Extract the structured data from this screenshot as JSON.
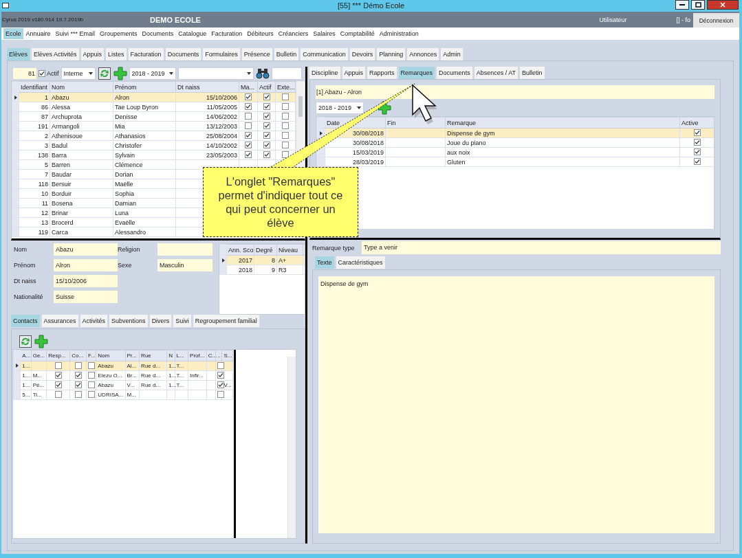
{
  "window": {
    "title": "[55] *** Démo Ecole"
  },
  "header": {
    "version": "Cyrus 2019 v180.914 19.7.2019b",
    "school": "DEMO ECOLE",
    "user_label": "Utilisateur",
    "user_value": "[] - fo",
    "logout": "Déconnexion"
  },
  "main_menu": [
    {
      "label": "Ecole",
      "selected": true
    },
    {
      "label": "Annuaire",
      "selected": false
    },
    {
      "label": "Suivi *** Email",
      "selected": false
    },
    {
      "label": "Groupements",
      "selected": false
    },
    {
      "label": "Documents",
      "selected": false
    },
    {
      "label": "Catalogue",
      "selected": false
    },
    {
      "label": "Facturation",
      "selected": false
    },
    {
      "label": "Débiteurs",
      "selected": false
    },
    {
      "label": "Créanciers",
      "selected": false
    },
    {
      "label": "Salaires",
      "selected": false
    },
    {
      "label": "Comptabilité",
      "selected": false
    },
    {
      "label": "Administration",
      "selected": false
    }
  ],
  "sub_tabs": [
    {
      "label": "Elèves",
      "selected": true
    },
    {
      "label": "Elèves Activités",
      "selected": false
    },
    {
      "label": "Appuis",
      "selected": false
    },
    {
      "label": "Listes",
      "selected": false
    },
    {
      "label": "Facturation",
      "selected": false
    },
    {
      "label": "Documents",
      "selected": false
    },
    {
      "label": "Formulaires",
      "selected": false
    },
    {
      "label": "Présence",
      "selected": false
    },
    {
      "label": "Bulletin",
      "selected": false
    },
    {
      "label": "Communication",
      "selected": false
    },
    {
      "label": "Devoirs",
      "selected": false
    },
    {
      "label": "Planning",
      "selected": false
    },
    {
      "label": "Annonces",
      "selected": false
    },
    {
      "label": "Admin",
      "selected": false
    }
  ],
  "students": {
    "toolbar": {
      "count": "81",
      "active": {
        "label": "Actif",
        "checked": true
      },
      "type": "Interne",
      "year": "2018 - 2019"
    },
    "columns": [
      "Identifiant",
      "Nom",
      "Prénom",
      "Dt naiss",
      "Ma...",
      "Actif",
      "Exte..."
    ],
    "rows": [
      {
        "id": "1",
        "nom": "Abazu",
        "prenom": "Alron",
        "dob": "15/10/2006",
        "checks": [
          true,
          true,
          false
        ],
        "selected": true
      },
      {
        "id": "86",
        "nom": "Alessa",
        "prenom": "Tae Loup Byron",
        "dob": "11/05/2005",
        "checks": [
          true,
          true,
          false
        ],
        "selected": false
      },
      {
        "id": "87",
        "nom": "Archuprota",
        "prenom": "Denisse",
        "dob": "14/06/2002",
        "checks": [
          false,
          true,
          false
        ],
        "selected": false
      },
      {
        "id": "191",
        "nom": "Armangoli",
        "prenom": "Mia",
        "dob": "13/12/2003",
        "checks": [
          false,
          true,
          false
        ],
        "selected": false
      },
      {
        "id": "2",
        "nom": "Athenisoue",
        "prenom": "Athanasios",
        "dob": "25/08/2004",
        "checks": [
          true,
          true,
          false
        ],
        "selected": false
      },
      {
        "id": "3",
        "nom": "Badul",
        "prenom": "Christofer",
        "dob": "14/10/2002",
        "checks": [
          true,
          true,
          false
        ],
        "selected": false
      },
      {
        "id": "138",
        "nom": "Barra",
        "prenom": "Sylvain",
        "dob": "23/05/2003",
        "checks": [
          true,
          true,
          false
        ],
        "selected": false
      },
      {
        "id": "5",
        "nom": "Barren",
        "prenom": "Clémence",
        "selected": false
      },
      {
        "id": "7",
        "nom": "Baudar",
        "prenom": "Dorian",
        "selected": false
      },
      {
        "id": "118",
        "nom": "Bersuir",
        "prenom": "Maëlle",
        "selected": false
      },
      {
        "id": "10",
        "nom": "Borduir",
        "prenom": "Sophia",
        "selected": false
      },
      {
        "id": "11",
        "nom": "Bosena",
        "prenom": "Damian",
        "selected": false
      },
      {
        "id": "12",
        "nom": "Brinar",
        "prenom": "Luna",
        "selected": false
      },
      {
        "id": "13",
        "nom": "Brocerd",
        "prenom": "Evaëlle",
        "selected": false
      },
      {
        "id": "119",
        "nom": "Carca",
        "prenom": "Alessandro",
        "selected": false
      }
    ]
  },
  "form": {
    "left_fields": [
      {
        "label": "Nom",
        "value": "Abazu"
      },
      {
        "label": "Prénom",
        "value": "Alron"
      },
      {
        "label": "Dt naiss",
        "value": "15/10/2006"
      },
      {
        "label": "Nationalité",
        "value": "Suisse"
      }
    ],
    "right_fields": [
      {
        "label": "Religion"
      },
      {
        "label": "Sexe",
        "value": "Masculin"
      }
    ]
  },
  "years": {
    "columns": [
      "Ann. Sco",
      "Degré",
      "Niveau"
    ],
    "rows": [
      {
        "cells": [
          "2017",
          "8",
          "A+"
        ],
        "selected": true
      },
      {
        "cells": [
          "2018",
          "9",
          "R3"
        ],
        "selected": false
      }
    ]
  },
  "family_tabs": [
    {
      "label": "Contacts",
      "selected": true
    },
    {
      "label": "Assurances",
      "selected": false
    },
    {
      "label": "Activités",
      "selected": false
    },
    {
      "label": "Subventions",
      "selected": false
    },
    {
      "label": "Divers",
      "selected": false
    },
    {
      "label": "Suivi",
      "selected": false
    },
    {
      "label": "Regroupement familial",
      "selected": false
    }
  ],
  "contacts": {
    "columns": [
      {
        "label": "A...",
        "kind": "text"
      },
      {
        "label": "Ge...",
        "kind": "text"
      },
      {
        "label": "Resp...",
        "kind": "check"
      },
      {
        "label": "Co...",
        "kind": "check"
      },
      {
        "label": "F...",
        "kind": "check"
      },
      {
        "label": "Nom",
        "kind": "text"
      },
      {
        "label": "Pr...",
        "kind": "text"
      },
      {
        "label": "Rue",
        "kind": "text"
      },
      {
        "label": "N",
        "kind": "text"
      },
      {
        "label": "L...",
        "kind": "text"
      },
      {
        "label": "Prof...",
        "kind": "text"
      },
      {
        "label": "C...",
        "kind": "text"
      },
      {
        "label": "..",
        "kind": "check"
      },
      {
        "label": "S...",
        "kind": "text"
      }
    ],
    "rows": [
      {
        "cells": [
          "1...",
          null,
          false,
          false,
          false,
          "Abazu",
          "Al...",
          "Rue d...",
          "1...",
          "T...",
          null,
          null,
          false,
          null
        ],
        "selected": true
      },
      {
        "cells": [
          "1...",
          "M...",
          true,
          true,
          false,
          "Elezu O...",
          "Br...",
          "Rue d...",
          "1...",
          "T...",
          "Infir...",
          null,
          true,
          null
        ],
        "selected": false
      },
      {
        "cells": [
          "1...",
          "Pè...",
          true,
          true,
          false,
          "Abazu",
          "V...",
          "Rue d...",
          "1...",
          "T...",
          null,
          null,
          true,
          "V..."
        ],
        "selected": false
      },
      {
        "cells": [
          "5...",
          "Ti...",
          false,
          false,
          false,
          "UDRISA...",
          "M...",
          null,
          null,
          null,
          null,
          null,
          false,
          null
        ],
        "selected": false
      }
    ]
  },
  "detail": {
    "tabs": [
      {
        "label": "Discipline",
        "selected": false
      },
      {
        "label": "Appuis",
        "selected": false
      },
      {
        "label": "Rapports",
        "selected": false
      },
      {
        "label": "Remarques",
        "selected": true
      },
      {
        "label": "Documents",
        "selected": false
      },
      {
        "label": "Absences / AT",
        "selected": false
      },
      {
        "label": "Bulletin",
        "selected": false
      }
    ],
    "student": "[1] Abazu - Alron",
    "year": "2018 - 2019",
    "columns": [
      "Date",
      "Fin",
      "Remarque",
      "Active"
    ],
    "rows": [
      {
        "date": "30/08/2018",
        "remark": "Dispense de gym",
        "active": true,
        "selected": true
      },
      {
        "date": "30/08/2018",
        "remark": "Joue du piano",
        "active": true,
        "selected": false
      },
      {
        "date": "15/03/2019",
        "remark": "aux noix",
        "active": true,
        "selected": false
      },
      {
        "date": "28/03/2019",
        "remark": "Gluten",
        "active": true,
        "selected": false
      }
    ],
    "remark_type": {
      "label": "Remarque type",
      "value": "Type a venir"
    },
    "text_tabs": [
      {
        "label": "Texte",
        "selected": true
      },
      {
        "label": "Caractéristiques",
        "selected": false
      }
    ],
    "text": "Dispense de gym"
  },
  "callout": {
    "text": "L'onglet \"Remarques\" permet d'indiquer tout ce qui peut concerner un élève"
  }
}
